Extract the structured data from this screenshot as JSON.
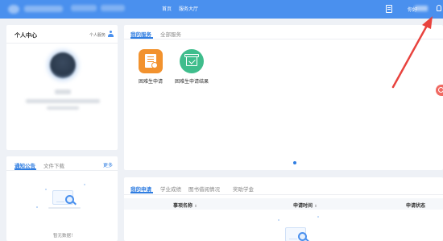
{
  "topbar": {
    "nav": [
      "首页",
      "服务大厅"
    ],
    "user_prefix": "你好"
  },
  "profile": {
    "title": "个人中心",
    "link": "个人服务"
  },
  "notice": {
    "tabs": [
      "通知公告",
      "文件下载"
    ],
    "more": "更多",
    "empty": "暂无数据！"
  },
  "services": {
    "tabs": [
      "我的服务",
      "全部服务"
    ],
    "items": [
      {
        "label": "困难生申请",
        "icon": "certificate-icon",
        "color": "#f2922e"
      },
      {
        "label": "困难生申请结果",
        "icon": "box-check-icon",
        "color": "#3fbd8c"
      }
    ]
  },
  "applications": {
    "tabs": [
      "我的申请",
      "学业成绩",
      "图书借阅情况",
      "奖助学金"
    ],
    "columns": [
      "事项名称",
      "申请时间",
      "申请状态"
    ]
  },
  "colors": {
    "primary": "#4a90ee",
    "accent": "#2f7de1",
    "arrow": "#e8433e"
  }
}
